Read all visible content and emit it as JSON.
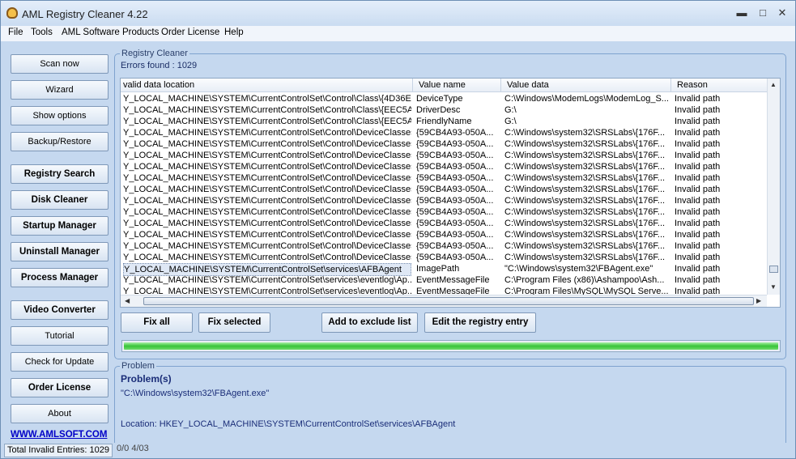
{
  "window": {
    "title": "AML Registry Cleaner 4.22",
    "minimize": "▬",
    "maximize": "□",
    "close": "✕"
  },
  "menu": [
    "File",
    "Tools",
    "AML Software Products",
    "Order License",
    "Help"
  ],
  "sidebar": {
    "buttons": [
      "Scan now",
      "Wizard",
      "Show options",
      "Backup/Restore",
      "Registry Search",
      "Disk Cleaner",
      "Startup Manager",
      "Uninstall Manager",
      "Process Manager",
      "Video Converter",
      "Tutorial",
      "Check for Update",
      "Order License",
      "About"
    ],
    "link": "WWW.AMLSOFT.COM"
  },
  "status": {
    "total": "Total Invalid Entries: 1029",
    "extra": "0/0 4/03"
  },
  "cleaner": {
    "group_title": "Registry Cleaner",
    "errors_found": "Errors found : 1029",
    "columns": [
      "valid data location",
      "Value name",
      "Value data",
      "Reason"
    ],
    "rows": [
      [
        "Y_LOCAL_MACHINE\\SYSTEM\\CurrentControlSet\\Control\\Class\\{4D36E...",
        "DeviceType",
        "C:\\Windows\\ModemLogs\\ModemLog_S...",
        "Invalid path"
      ],
      [
        "Y_LOCAL_MACHINE\\SYSTEM\\CurrentControlSet\\Control\\Class\\{EEC5A...",
        "DriverDesc",
        "G:\\",
        "Invalid path"
      ],
      [
        "Y_LOCAL_MACHINE\\SYSTEM\\CurrentControlSet\\Control\\Class\\{EEC5A...",
        "FriendlyName",
        "G:\\",
        "Invalid path"
      ],
      [
        "Y_LOCAL_MACHINE\\SYSTEM\\CurrentControlSet\\Control\\DeviceClasses...",
        "{59CB4A93-050A...",
        "C:\\Windows\\system32\\SRSLabs\\{176F...",
        "Invalid path"
      ],
      [
        "Y_LOCAL_MACHINE\\SYSTEM\\CurrentControlSet\\Control\\DeviceClasses...",
        "{59CB4A93-050A...",
        "C:\\Windows\\system32\\SRSLabs\\{176F...",
        "Invalid path"
      ],
      [
        "Y_LOCAL_MACHINE\\SYSTEM\\CurrentControlSet\\Control\\DeviceClasses...",
        "{59CB4A93-050A...",
        "C:\\Windows\\system32\\SRSLabs\\{176F...",
        "Invalid path"
      ],
      [
        "Y_LOCAL_MACHINE\\SYSTEM\\CurrentControlSet\\Control\\DeviceClasses...",
        "{59CB4A93-050A...",
        "C:\\Windows\\system32\\SRSLabs\\{176F...",
        "Invalid path"
      ],
      [
        "Y_LOCAL_MACHINE\\SYSTEM\\CurrentControlSet\\Control\\DeviceClasses...",
        "{59CB4A93-050A...",
        "C:\\Windows\\system32\\SRSLabs\\{176F...",
        "Invalid path"
      ],
      [
        "Y_LOCAL_MACHINE\\SYSTEM\\CurrentControlSet\\Control\\DeviceClasses...",
        "{59CB4A93-050A...",
        "C:\\Windows\\system32\\SRSLabs\\{176F...",
        "Invalid path"
      ],
      [
        "Y_LOCAL_MACHINE\\SYSTEM\\CurrentControlSet\\Control\\DeviceClasses...",
        "{59CB4A93-050A...",
        "C:\\Windows\\system32\\SRSLabs\\{176F...",
        "Invalid path"
      ],
      [
        "Y_LOCAL_MACHINE\\SYSTEM\\CurrentControlSet\\Control\\DeviceClasses...",
        "{59CB4A93-050A...",
        "C:\\Windows\\system32\\SRSLabs\\{176F...",
        "Invalid path"
      ],
      [
        "Y_LOCAL_MACHINE\\SYSTEM\\CurrentControlSet\\Control\\DeviceClasses...",
        "{59CB4A93-050A...",
        "C:\\Windows\\system32\\SRSLabs\\{176F...",
        "Invalid path"
      ],
      [
        "Y_LOCAL_MACHINE\\SYSTEM\\CurrentControlSet\\Control\\DeviceClasses...",
        "{59CB4A93-050A...",
        "C:\\Windows\\system32\\SRSLabs\\{176F...",
        "Invalid path"
      ],
      [
        "Y_LOCAL_MACHINE\\SYSTEM\\CurrentControlSet\\Control\\DeviceClasses...",
        "{59CB4A93-050A...",
        "C:\\Windows\\system32\\SRSLabs\\{176F...",
        "Invalid path"
      ],
      [
        "Y_LOCAL_MACHINE\\SYSTEM\\CurrentControlSet\\Control\\DeviceClasses...",
        "{59CB4A93-050A...",
        "C:\\Windows\\system32\\SRSLabs\\{176F...",
        "Invalid path"
      ],
      [
        "Y_LOCAL_MACHINE\\SYSTEM\\CurrentControlSet\\services\\AFBAgent",
        "ImagePath",
        "\"C:\\Windows\\system32\\FBAgent.exe\"",
        "Invalid path"
      ],
      [
        "Y_LOCAL_MACHINE\\SYSTEM\\CurrentControlSet\\services\\eventlog\\Ap...",
        "EventMessageFile",
        "C:\\Program Files (x86)\\Ashampoo\\Ash...",
        "Invalid path"
      ],
      [
        "Y_LOCAL_MACHINE\\SYSTEM\\CurrentControlSet\\services\\eventlog\\Ap...",
        "EventMessageFile",
        "C:\\Program Files\\MySQL\\MySQL Serve...",
        "Invalid path"
      ]
    ],
    "selected_row": 15,
    "actions": {
      "fix_all": "Fix all",
      "fix_selected": "Fix selected",
      "exclude": "Add to exclude list",
      "edit": "Edit the registry entry"
    },
    "progress": 1.0
  },
  "problem": {
    "group_title": "Problem",
    "label": "Problem(s)",
    "value": "\"C:\\Windows\\system32\\FBAgent.exe\"",
    "location": "Location: HKEY_LOCAL_MACHINE\\SYSTEM\\CurrentControlSet\\services\\AFBAgent"
  },
  "colors": {
    "window_bg": "#c5d8ef",
    "progress": "#37c338",
    "accent_text": "#1a2d78",
    "link": "#0000c8"
  }
}
